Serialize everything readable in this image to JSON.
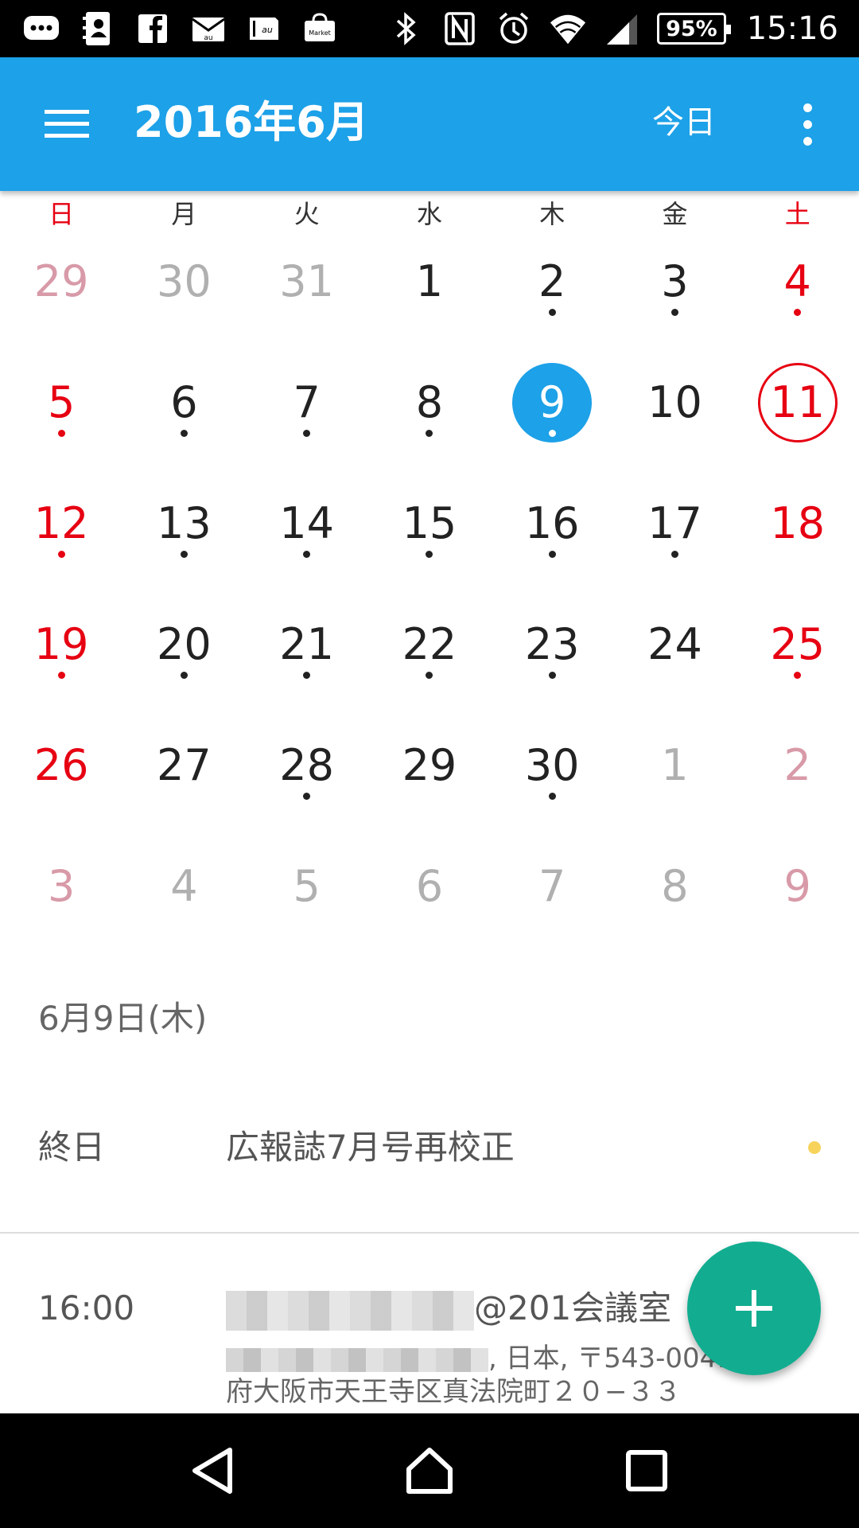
{
  "status_bar": {
    "left_icons": [
      "chat-notification-icon",
      "contacts-icon",
      "facebook-icon",
      "au-mail-icon",
      "au-app-icon",
      "market-icon"
    ],
    "right_icons": [
      "bluetooth-icon",
      "nfc-icon",
      "alarm-icon",
      "wifi-icon",
      "signal-icon"
    ],
    "battery": "95%",
    "time": "15:16"
  },
  "app_bar": {
    "title": "2016年6月",
    "today_label": "今日",
    "background": "#1da1e8"
  },
  "calendar": {
    "weekdays": [
      {
        "label": "日",
        "style": "red"
      },
      {
        "label": "月",
        "style": "normal"
      },
      {
        "label": "火",
        "style": "normal"
      },
      {
        "label": "水",
        "style": "normal"
      },
      {
        "label": "木",
        "style": "normal"
      },
      {
        "label": "金",
        "style": "normal"
      },
      {
        "label": "土",
        "style": "red"
      }
    ],
    "weeks": [
      [
        {
          "day": "29",
          "style": "pink",
          "dot": false
        },
        {
          "day": "30",
          "style": "grey",
          "dot": false
        },
        {
          "day": "31",
          "style": "grey",
          "dot": false
        },
        {
          "day": "1",
          "style": "normal",
          "dot": false
        },
        {
          "day": "2",
          "style": "normal",
          "dot": true
        },
        {
          "day": "3",
          "style": "normal",
          "dot": true
        },
        {
          "day": "4",
          "style": "red",
          "dot": true
        }
      ],
      [
        {
          "day": "5",
          "style": "red",
          "dot": true
        },
        {
          "day": "6",
          "style": "normal",
          "dot": true
        },
        {
          "day": "7",
          "style": "normal",
          "dot": true
        },
        {
          "day": "8",
          "style": "normal",
          "dot": true
        },
        {
          "day": "9",
          "style": "selected",
          "dot": true
        },
        {
          "day": "10",
          "style": "normal",
          "dot": false
        },
        {
          "day": "11",
          "style": "today-red",
          "dot": false
        }
      ],
      [
        {
          "day": "12",
          "style": "red",
          "dot": true
        },
        {
          "day": "13",
          "style": "normal",
          "dot": true
        },
        {
          "day": "14",
          "style": "normal",
          "dot": true
        },
        {
          "day": "15",
          "style": "normal",
          "dot": true
        },
        {
          "day": "16",
          "style": "normal",
          "dot": true
        },
        {
          "day": "17",
          "style": "normal",
          "dot": true
        },
        {
          "day": "18",
          "style": "red",
          "dot": false
        }
      ],
      [
        {
          "day": "19",
          "style": "red",
          "dot": true
        },
        {
          "day": "20",
          "style": "normal",
          "dot": true
        },
        {
          "day": "21",
          "style": "normal",
          "dot": true
        },
        {
          "day": "22",
          "style": "normal",
          "dot": true
        },
        {
          "day": "23",
          "style": "normal",
          "dot": true
        },
        {
          "day": "24",
          "style": "normal",
          "dot": false
        },
        {
          "day": "25",
          "style": "red",
          "dot": true
        }
      ],
      [
        {
          "day": "26",
          "style": "red",
          "dot": false
        },
        {
          "day": "27",
          "style": "normal",
          "dot": false
        },
        {
          "day": "28",
          "style": "normal",
          "dot": true
        },
        {
          "day": "29",
          "style": "normal",
          "dot": false
        },
        {
          "day": "30",
          "style": "normal",
          "dot": true
        },
        {
          "day": "1",
          "style": "grey",
          "dot": false
        },
        {
          "day": "2",
          "style": "pink",
          "dot": false
        }
      ],
      [
        {
          "day": "3",
          "style": "pink",
          "dot": false
        },
        {
          "day": "4",
          "style": "grey",
          "dot": false
        },
        {
          "day": "5",
          "style": "grey",
          "dot": false
        },
        {
          "day": "6",
          "style": "grey",
          "dot": false
        },
        {
          "day": "7",
          "style": "grey",
          "dot": false
        },
        {
          "day": "8",
          "style": "grey",
          "dot": false
        },
        {
          "day": "9",
          "style": "pink",
          "dot": false
        }
      ]
    ]
  },
  "agenda": {
    "date_heading": "6月9日(木)",
    "events": [
      {
        "time": "終日",
        "title": "広報誌7月号再校正",
        "dot_color": "#f7d35c"
      },
      {
        "time": "16:00",
        "title_visible": "@201会議室",
        "location_line1": ", 日本, 〒543-0041",
        "location_line2": "府大阪市天王寺区真法院町２０−３３",
        "dot_color": "#f7d35c"
      }
    ]
  },
  "fab": {
    "icon": "plus-icon",
    "color": "#12ad90"
  },
  "nav_bar": {
    "icons": [
      "back-icon",
      "home-icon",
      "recents-icon"
    ]
  }
}
